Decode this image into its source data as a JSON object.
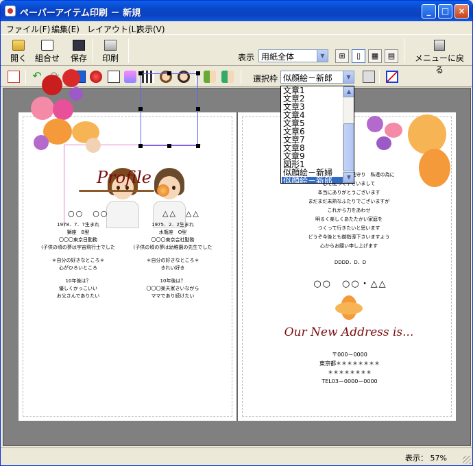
{
  "window": {
    "title": "ペーパーアイテム印刷 － 新規",
    "controls": {
      "minimize": "_",
      "maximize": "□",
      "close": "×"
    }
  },
  "menubar": {
    "items": [
      "ファイル(F)",
      "編集(E)",
      "レイアウト(L)",
      "表示(V)"
    ]
  },
  "toolbar1": {
    "open": "開く",
    "combine": "組合せ",
    "save": "保存",
    "print": "印刷",
    "display_label": "表示",
    "display_value": "用紙全体",
    "menu_return": "メニューに戻る",
    "icons": [
      "open-folder-icon",
      "book-icon",
      "floppy-icon",
      "printer-icon"
    ]
  },
  "toolbar2": {
    "select_label": "選択枠",
    "select_value": "似顔絵－新郎"
  },
  "dropdown": {
    "items": [
      "文章1",
      "文章2",
      "文章3",
      "文章4",
      "文章5",
      "文章6",
      "文章7",
      "文章8",
      "文章9",
      "図形1",
      "似顔絵－新婦",
      "似顔絵－新郎"
    ],
    "selected_index": 11
  },
  "left_page": {
    "title": "Profile",
    "name_left": "○○　○○",
    "name_right": "△△　△△",
    "col_left": [
      "1978．7．7生まれ",
      "獅座　B型",
      "〇〇〇東京日勤務",
      "(子供の頃の夢は宇宙飛行士でした",
      "",
      "＊自分の好きなところ＊",
      "心がひろいところ",
      "",
      "10年後は？",
      "優しくかっこいい",
      "お父さんでありたい"
    ],
    "col_right": [
      "1975．2．2生まれ",
      "水瓶座　O型",
      "〇〇〇東京会社勤務",
      "(子供の頃の夢は幼稚園の先生でした",
      "",
      "＊自分の好きなところ＊",
      "きれい好き",
      "",
      "10年後は？",
      "〇〇〇楽天家きいながら",
      "ママであり続けたい"
    ]
  },
  "right_page": {
    "poem": [
      "これまで私達を暖かく見守り　私達の為に",
      "心を配って下さいまして",
      "本当にありがとうございます",
      "まだまだ未熟なふたりでございますが",
      "これから力をあわせ",
      "明るく楽しくあたたかい家庭を",
      "つくって行きたいと思います",
      "どうぞ今後とも御指導下さいますよう",
      "心からお願い申し上げます"
    ],
    "date": "DDDD．D．D",
    "names": "○○　○○・△△",
    "address_title": "Our New Address is...",
    "address": [
      "〒000－0000",
      "東京都＊＊＊＊＊＊＊＊",
      "＊＊＊＊＊＊＊＊",
      "TEL03－0000－0000"
    ]
  },
  "statusbar": {
    "text": "表示： 57%"
  }
}
